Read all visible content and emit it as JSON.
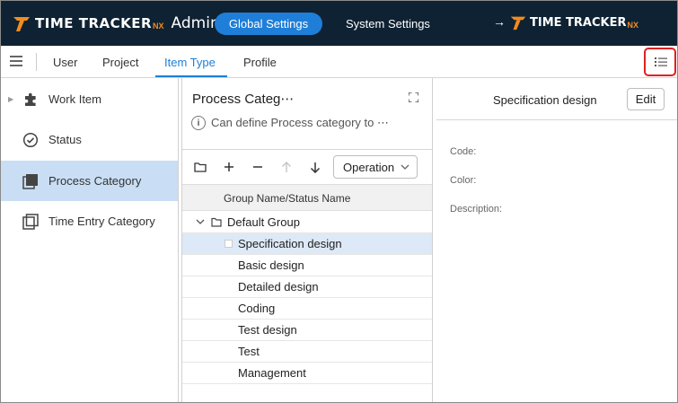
{
  "header": {
    "brand_name": "TIME TRACKER",
    "brand_suffix": "NX",
    "brand_area": "Admin",
    "nav_active": "Global Settings",
    "nav_other": "System Settings",
    "switch_arrow": "→"
  },
  "tabs": [
    {
      "label": "User"
    },
    {
      "label": "Project"
    },
    {
      "label": "Item Type",
      "active": true
    },
    {
      "label": "Profile"
    }
  ],
  "sidebar": {
    "items": [
      {
        "label": "Work Item",
        "icon": "puzzle-icon"
      },
      {
        "label": "Status",
        "icon": "check-circle-icon"
      },
      {
        "label": "Process Category",
        "icon": "layers-icon",
        "active": true
      },
      {
        "label": "Time Entry Category",
        "icon": "layers-outline-icon"
      }
    ]
  },
  "middle": {
    "title": "Process Categ⋯",
    "info_text": "Can define Process category to ⋯",
    "operation_label": "Operation",
    "column_header": "Group Name/Status Name",
    "group_name": "Default Group",
    "rows": [
      {
        "label": "Specification design",
        "selected": true
      },
      {
        "label": "Basic design"
      },
      {
        "label": "Detailed design"
      },
      {
        "label": "Coding"
      },
      {
        "label": "Test design"
      },
      {
        "label": "Test"
      },
      {
        "label": "Management"
      }
    ]
  },
  "detail": {
    "title": "Specification design",
    "edit_label": "Edit",
    "fields": [
      {
        "label": "Code:"
      },
      {
        "label": "Color:"
      },
      {
        "label": "Description:"
      }
    ]
  },
  "colors": {
    "topbar": "#0f2233",
    "accent": "#1e7ed8",
    "brand_orange": "#f28c1e",
    "highlight": "#e02020"
  }
}
